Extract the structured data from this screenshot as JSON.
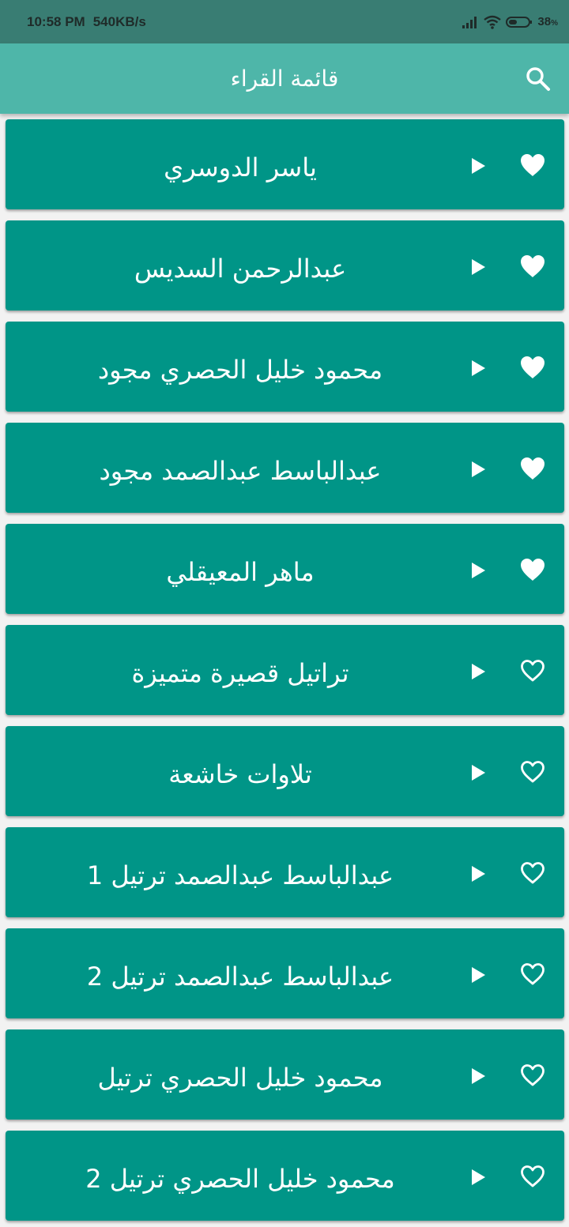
{
  "status_bar": {
    "time": "10:58 PM",
    "speed": "540KB/s",
    "battery": "38",
    "battery_unit": "%"
  },
  "app_bar": {
    "title": "قائمة القراء",
    "search_icon": "search-icon"
  },
  "colors": {
    "status_bar": "#397d73",
    "app_bar": "#4eb6a9",
    "card": "#009587",
    "background": "#f2f2f2"
  },
  "reciters": [
    {
      "name": "ياسر الدوسري",
      "favorite": true
    },
    {
      "name": "عبدالرحمن السديس",
      "favorite": true
    },
    {
      "name": "محمود خليل الحصري مجود",
      "favorite": true
    },
    {
      "name": "عبدالباسط عبدالصمد مجود",
      "favorite": true
    },
    {
      "name": "ماهر المعيقلي",
      "favorite": true
    },
    {
      "name": "تراتيل قصيرة متميزة",
      "favorite": false
    },
    {
      "name": "تلاوات خاشعة",
      "favorite": false
    },
    {
      "name": "عبدالباسط عبدالصمد ترتيل 1",
      "favorite": false
    },
    {
      "name": "عبدالباسط عبدالصمد ترتيل 2",
      "favorite": false
    },
    {
      "name": "محمود خليل الحصري ترتيل",
      "favorite": false
    },
    {
      "name": "محمود خليل الحصري ترتيل 2",
      "favorite": false
    }
  ]
}
